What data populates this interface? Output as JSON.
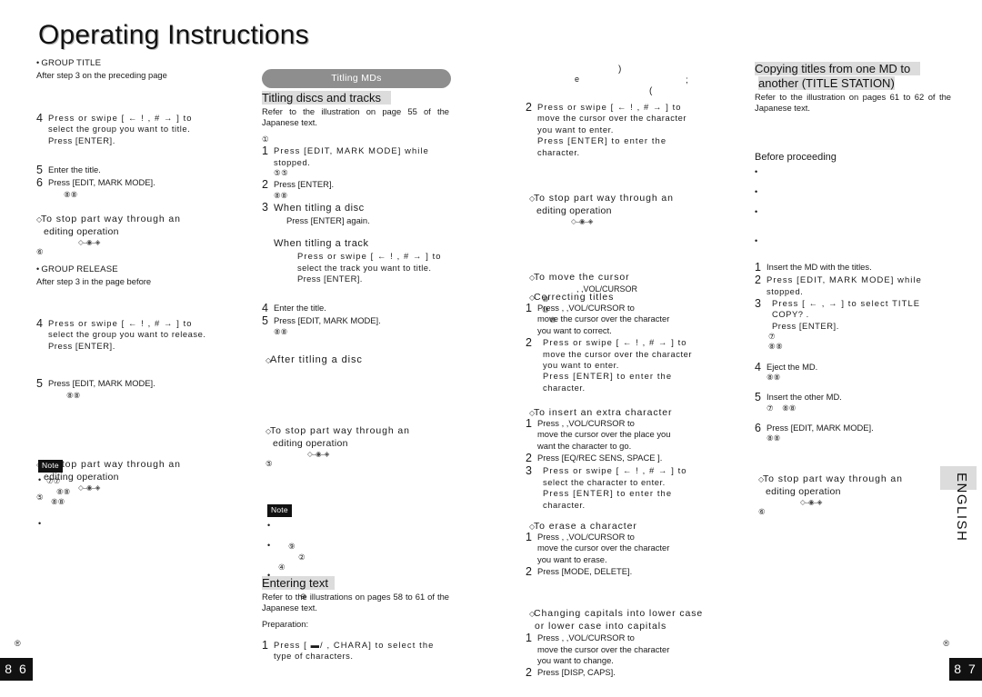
{
  "masthead": "Operating Instructions",
  "english_tab": "ENGLISH",
  "pages": {
    "left": "8 6",
    "right": "8 7"
  },
  "registered_mark": "®",
  "arrow_bracket": "[ ←  !   , #  →  ]",
  "arrow_bracket_short": "[ ←  ,  →  ]",
  "column1": {
    "group_title": {
      "heading": "GROUP TITLE",
      "subtitle": "After step 3 on the preceding page",
      "steps": [
        {
          "num": "4",
          "lines": [
            "Press or swipe [  ←  !   , #  →  ] to",
            "select the group you want to title.",
            "Press [ENTER]."
          ]
        },
        {
          "num": "5",
          "lines": [
            "Enter the title."
          ]
        },
        {
          "num": "6",
          "lines": [
            "Press [EDIT, MARK MODE]."
          ]
        }
      ],
      "after_circle": "⑧⑧"
    },
    "stop_heading_1": {
      "line1": "To stop part way through an",
      "line2": "editing operation",
      "dots": "◇–◉–◈",
      "circle": "⑥"
    },
    "group_release": {
      "heading": "GROUP RELEASE",
      "subtitle": "After step 3 in the page before",
      "steps": [
        {
          "num": "4",
          "lines": [
            "Press or swipe [  ←  !   , #  →  ] to",
            "select the group you want to release.",
            "Press [ENTER]."
          ]
        },
        {
          "num": "5",
          "lines": [
            "Press [EDIT, MARK MODE]."
          ]
        }
      ],
      "after_circle": "⑧⑧"
    },
    "stop_heading_2": {
      "line1": "To stop part way through an",
      "line2": "editing operation",
      "dots": "◇–◉–◈",
      "circle": "⑤"
    },
    "note": {
      "label": "Note",
      "items": [
        "⑦⑦",
        "⑧⑧",
        "⑧⑧",
        ""
      ]
    }
  },
  "column2": {
    "pill": "Titling MDs",
    "title_head": "Titling discs and tracks",
    "ref": "Refer to the illustration on page 55 of the Japanese text.",
    "lead_circle": "①",
    "steps": [
      {
        "num": "1",
        "lines": [
          "Press [EDIT,  MARK  MODE]  while",
          "stopped."
        ],
        "circle": "⑤⑤"
      },
      {
        "num": "2",
        "lines": [
          "Press [ENTER]."
        ],
        "circle": "⑧⑧"
      },
      {
        "num": "3",
        "lines": []
      }
    ],
    "when_disc": {
      "heading": "When titling a disc",
      "body": "Press [ENTER] again."
    },
    "when_track": {
      "heading": "When titling a track",
      "lines": [
        "Press or swipe [  ←  !   , #  →  ] to",
        "select the track you want to title.",
        "Press [ENTER]."
      ]
    },
    "steps2": [
      {
        "num": "4",
        "lines": [
          "Enter the title."
        ]
      },
      {
        "num": "5",
        "lines": [
          "Press [EDIT, MARK MODE]."
        ],
        "circle": "⑧⑧"
      }
    ],
    "after_titling": "After titling a disc",
    "stop_heading": {
      "line1": "To stop part way through an",
      "line2": "editing operation",
      "dots": "◇–◉–◈",
      "circle": "⑤"
    },
    "note": {
      "label": "Note",
      "items": [
        "",
        "⑨",
        "②",
        "④",
        "①",
        "⊖"
      ]
    },
    "entering_text": {
      "head": "Entering text",
      "ref": "Refer to the illustrations on pages 58 to 61 of the Japanese text.",
      "prep": "Preparation:",
      "step": {
        "num": "1",
        "lines": [
          "Press [  ▬/   , CHARA]  to select the",
          "type of characters."
        ]
      }
    }
  },
  "column3": {
    "artifacts": [
      ")",
      "e",
      ";",
      "("
    ],
    "step2": {
      "num": "2",
      "lines": [
        "Press or swipe [  ←  !  , #  →  ] to",
        "move the cursor over the character",
        "you want to enter.",
        "Press  [ENTER]  to  enter  the",
        "character."
      ]
    },
    "stop_heading": {
      "line1": "To stop part way through an",
      "line2": "editing operation",
      "dots": "◇–◉–◈"
    },
    "move_cursor": {
      "heading": "To move the cursor",
      "body": ",        ,VOL/CURSOR",
      "circles": [
        "⑩",
        "⑩",
        "⑩"
      ]
    },
    "correcting": {
      "heading": "Correcting titles",
      "steps": [
        {
          "num": "1",
          "lines": [
            "Press           ,          ,VOL/CURSOR  to",
            "move the cursor over the character",
            "you want to correct."
          ]
        },
        {
          "num": "2",
          "lines": [
            "Press or swipe [  ←  !   , #  →  ] to",
            "move the cursor over the character",
            "you want to enter.",
            "Press  [ENTER]  to  enter  the",
            "character."
          ]
        }
      ]
    },
    "insert": {
      "heading": "To insert an extra character",
      "steps": [
        {
          "num": "1",
          "lines": [
            "Press           ,          ,VOL/CURSOR  to",
            "move the cursor over the place you",
            "want the character to go."
          ]
        },
        {
          "num": "2",
          "lines": [
            "Press [EQ/REC SENS, SPACE ]."
          ]
        },
        {
          "num": "3",
          "lines": [
            "Press or swipe [  ←  !   , #  →  ] to",
            "select the character to enter.",
            "Press  [ENTER]  to  enter  the",
            "character."
          ]
        }
      ]
    },
    "erase": {
      "heading": "To erase a character",
      "steps": [
        {
          "num": "1",
          "lines": [
            "Press          ,           ,VOL/CURSOR  to",
            "move the cursor over the character",
            "you want to erase."
          ]
        },
        {
          "num": "2",
          "lines": [
            "Press [MODE, DELETE]."
          ]
        }
      ]
    },
    "caps": {
      "heading_line1": "Changing capitals into lower case",
      "heading_line2": "or lower case into capitals",
      "steps": [
        {
          "num": "1",
          "lines": [
            "Press           ,          ,VOL/CURSOR  to",
            "move the cursor over the character",
            "you want to change."
          ]
        },
        {
          "num": "2",
          "lines": [
            "Press [DISP, CAPS]."
          ]
        }
      ]
    }
  },
  "column4": {
    "head_line1": "Copying titles from one MD to",
    "head_line2": "another (TITLE STATION)",
    "ref": "Refer to the illustration on pages 61 to 62 of the Japanese text.",
    "before": {
      "heading": "Before proceeding",
      "items": [
        "",
        "",
        "",
        ""
      ]
    },
    "steps": [
      {
        "num": "1",
        "lines": [
          "Insert the MD with the titles."
        ]
      },
      {
        "num": "2",
        "lines": [
          "Press [EDIT,  MARK  MODE]  while",
          "stopped."
        ]
      },
      {
        "num": "3",
        "lines": [
          "Press [  ←  ,  →  ] to select  TITLE",
          "COPY? .",
          "Press [ENTER]."
        ],
        "circles": [
          "⑦",
          "⑧⑧"
        ]
      },
      {
        "num": "4",
        "lines": [
          "Eject the MD."
        ],
        "circles": [
          "⑧⑧"
        ]
      },
      {
        "num": "5",
        "lines": [
          "Insert the other MD."
        ],
        "circles": [
          "⑦",
          "⑧⑧"
        ]
      },
      {
        "num": "6",
        "lines": [
          "Press [EDIT, MARK MODE]."
        ],
        "circles": [
          "⑧⑧"
        ]
      }
    ],
    "stop_heading": {
      "line1": "To stop part way through an",
      "line2": "editing operation",
      "dots": "◇–◉–◈",
      "circle": "⑥"
    }
  }
}
